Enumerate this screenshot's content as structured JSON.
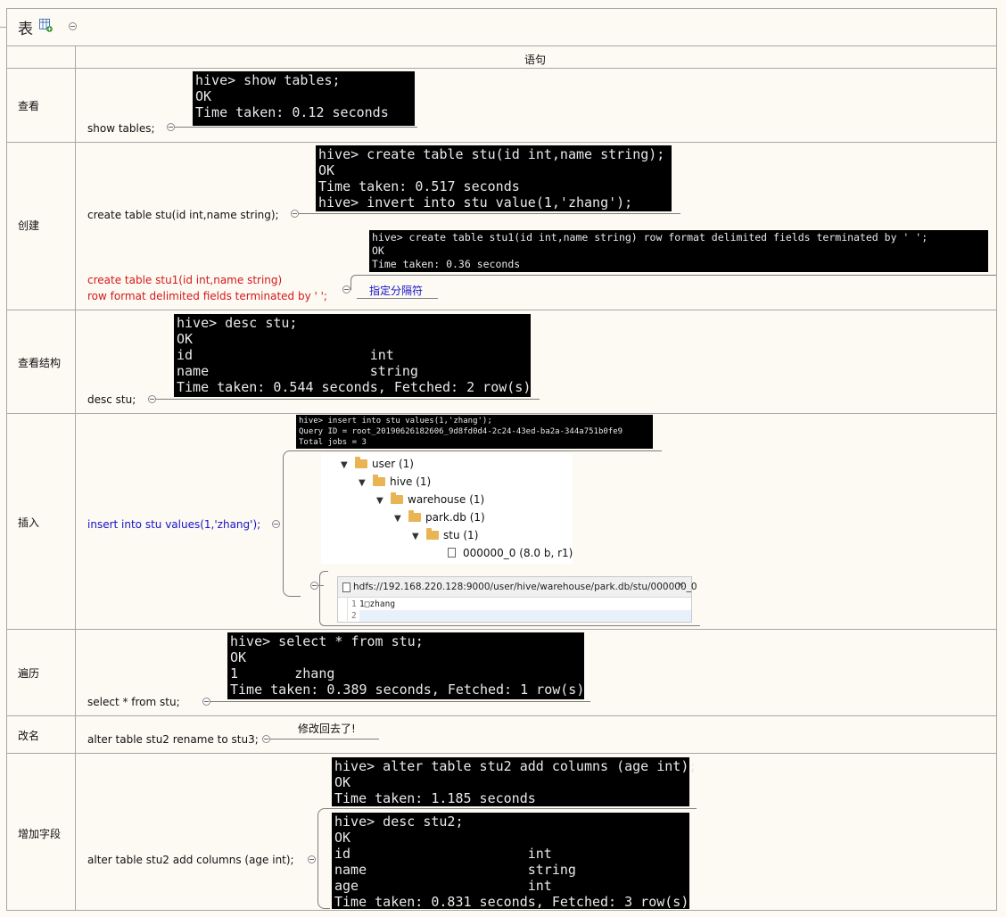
{
  "title": "表",
  "header": {
    "column_label": "语句"
  },
  "rows": {
    "view": {
      "label": "查看",
      "statement": "show tables;",
      "terminal": "hive> show tables;\nOK\nTime taken: 0.12 seconds"
    },
    "create": {
      "label": "创建",
      "statement1": "create table stu(id int,name string);",
      "terminal1": "hive> create table stu(id int,name string);\nOK\nTime taken: 0.517 seconds\nhive> invert into stu value(1,'zhang');",
      "statement2_line1": "create table stu1(id int,name string)",
      "statement2_line2": "row format delimited fields terminated by ' ';",
      "terminal2": "hive> create table stu1(id int,name string) row format delimited fields terminated by ' ';\nOK\nTime taken: 0.36 seconds",
      "note": "指定分隔符"
    },
    "describe": {
      "label": "查看结构",
      "statement": "desc stu;",
      "terminal": "hive> desc stu;\nOK\nid                      int\nname                    string\nTime taken: 0.544 seconds, Fetched: 2 row(s)"
    },
    "insert": {
      "label": "插入",
      "statement": "insert into stu values(1,'zhang');",
      "terminal": "hive> insert into stu values(1,'zhang');\nQuery ID = root_20190626182606_9d8fd0d4-2c24-43ed-ba2a-344a751b0fe9\nTotal jobs = 3",
      "tree": [
        {
          "label": "user (1)",
          "icon": "folder-icon"
        },
        {
          "label": "hive (1)",
          "icon": "folder-icon"
        },
        {
          "label": "warehouse (1)",
          "icon": "folder-icon"
        },
        {
          "label": "park.db (1)",
          "icon": "folder-icon"
        },
        {
          "label": "stu (1)",
          "icon": "folder-icon"
        },
        {
          "label": "000000_0 (8.0 b, r1)",
          "icon": "file-icon"
        }
      ],
      "editor_tab": "hdfs://192.168.220.128:9000/user/hive/warehouse/park.db/stu/000000_0",
      "editor_lines": [
        {
          "num": "1",
          "text": "1□zhang"
        },
        {
          "num": "2",
          "text": ""
        }
      ]
    },
    "traverse": {
      "label": "遍历",
      "statement": "select * from stu;",
      "terminal": "hive> select * from stu;\nOK\n1       zhang\nTime taken: 0.389 seconds, Fetched: 1 row(s)"
    },
    "rename": {
      "label": "改名",
      "statement": "alter table stu2 rename to stu3;",
      "note": "修改回去了!"
    },
    "add_column": {
      "label": "增加字段",
      "statement": "alter table stu2 add columns (age int);",
      "terminal1": "hive> alter table stu2 add columns (age int);\nOK\nTime taken: 1.185 seconds",
      "terminal2": "hive> desc stu2;\nOK\nid                      int\nname                    string\nage                     int\nTime taken: 0.831 seconds, Fetched: 3 row(s)"
    }
  },
  "colors": {
    "red_text": "#d41919",
    "blue_text": "#1414c8",
    "terminal_bg": "#000000"
  }
}
